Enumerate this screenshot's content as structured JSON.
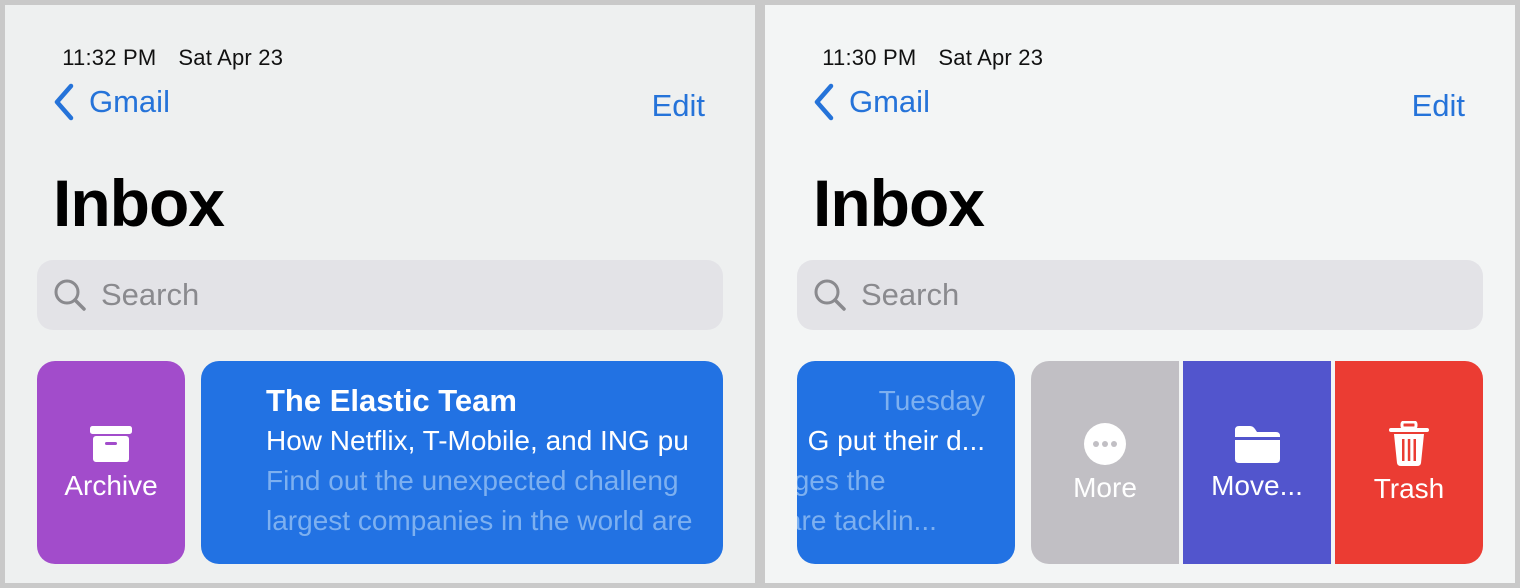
{
  "left": {
    "status_bar": {
      "time": "11:32 PM",
      "date": "Sat Apr 23"
    },
    "nav": {
      "back_label": "Gmail",
      "edit_label": "Edit"
    },
    "title": "Inbox",
    "search": {
      "placeholder": "Search"
    },
    "swipe_action": {
      "label": "Archive",
      "icon": "archive-box-icon",
      "color": "#a24ccb"
    },
    "email": {
      "sender": "The Elastic Team",
      "subject": "How Netflix, T-Mobile, and ING pu",
      "preview_line1": "Find out the unexpected challeng",
      "preview_line2": "largest companies in the world are"
    }
  },
  "right": {
    "status_bar": {
      "time": "11:30 PM",
      "date": "Sat Apr 23"
    },
    "nav": {
      "back_label": "Gmail",
      "edit_label": "Edit"
    },
    "title": "Inbox",
    "search": {
      "placeholder": "Search"
    },
    "email": {
      "date": "Tuesday",
      "subject": "G put their d...",
      "preview_line1": "enges the",
      "preview_line2": "d are tacklin..."
    },
    "swipe_actions": [
      {
        "label": "More",
        "icon": "ellipsis-circle-icon",
        "color": "#c1bfc4"
      },
      {
        "label": "Move...",
        "icon": "folder-icon",
        "color": "#5255cd"
      },
      {
        "label": "Trash",
        "icon": "trash-icon",
        "color": "#eb3c33"
      }
    ]
  },
  "colors": {
    "accent": "#2573d9",
    "email_card": "#2272e3",
    "preview_text": "#7db0f0"
  }
}
